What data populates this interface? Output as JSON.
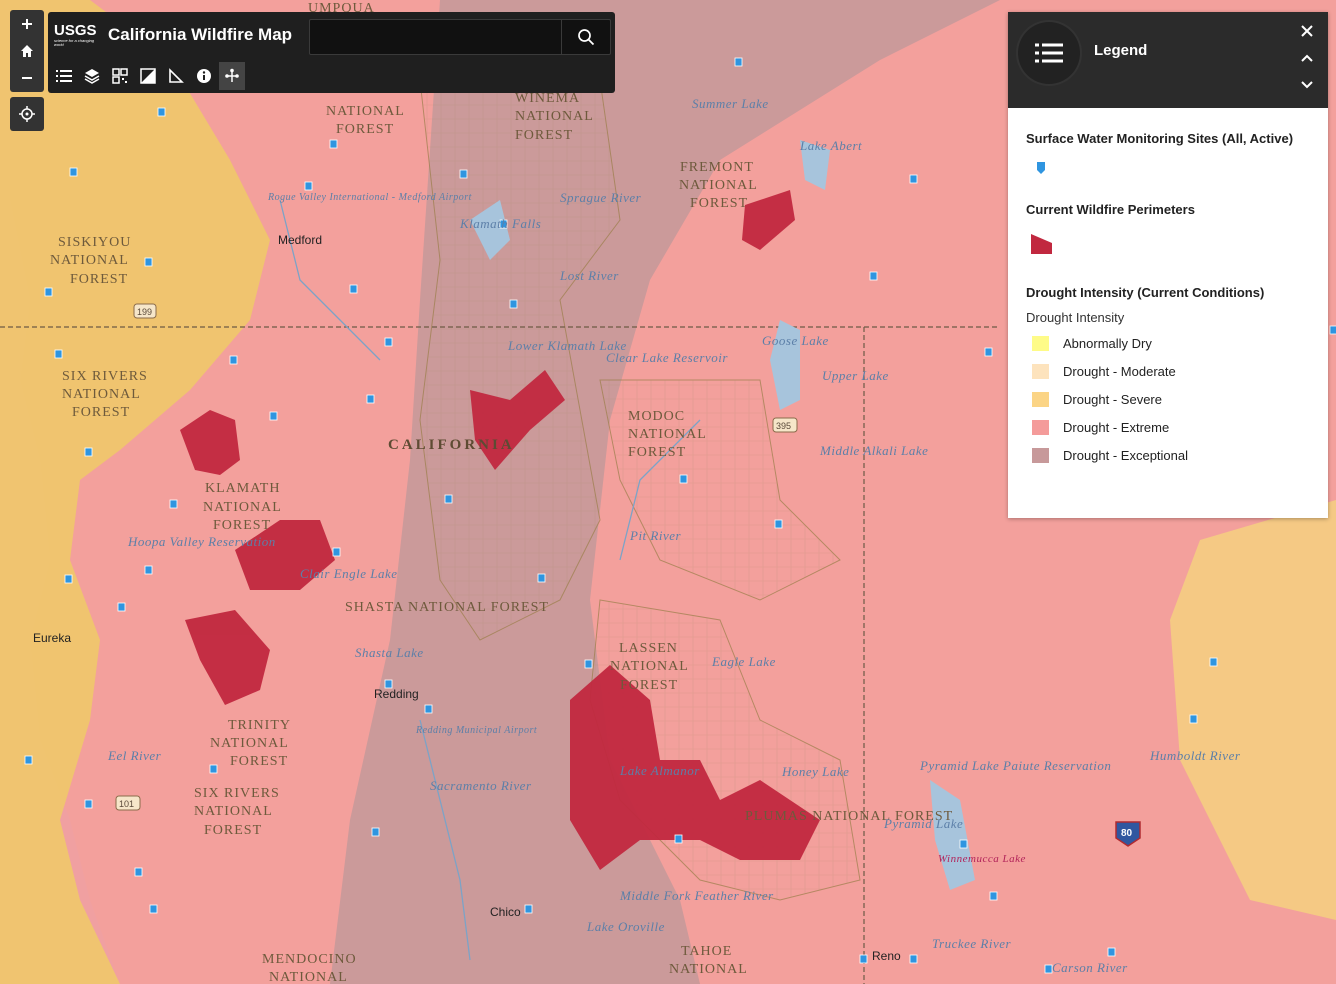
{
  "app": {
    "org_logo": "USGS",
    "org_tagline": "science for a changing world",
    "title": "California Wildfire Map",
    "search_placeholder": ""
  },
  "toolbar": [
    "list-icon",
    "layers-icon",
    "qr-icon",
    "basemap-icon",
    "measure-icon",
    "info-icon",
    "share-icon"
  ],
  "legend": {
    "title": "Legend",
    "sections": [
      {
        "heading": "Surface Water Monitoring Sites (All, Active)",
        "symbol_color": "#2f95e0"
      },
      {
        "heading": "Current Wildfire Perimeters",
        "symbol_color": "#c1283f"
      },
      {
        "heading": "Drought Intensity (Current Conditions)",
        "subheading": "Drought Intensity",
        "items": [
          {
            "label": "Abnormally Dry",
            "color": "#fefb88"
          },
          {
            "label": "Drought - Moderate",
            "color": "#fde3bd"
          },
          {
            "label": "Drought - Severe",
            "color": "#fbd485"
          },
          {
            "label": "Drought - Extreme",
            "color": "#f49b9a"
          },
          {
            "label": "Drought - Exceptional",
            "color": "#c7999a"
          }
        ]
      }
    ]
  },
  "map": {
    "labels": {
      "umpqua": "UMPQUA",
      "national1": "NATIONAL",
      "forest1": "FOREST",
      "winema": "WINEMA",
      "national2": "NATIONAL",
      "forest2": "FOREST",
      "summer_lake": "Summer Lake",
      "fremont": "FREMONT",
      "national3": "NATIONAL",
      "forest3": "FOREST",
      "lake_abert": "Lake Abert",
      "rogue_valley": "Rogue Valley International - Medford Airport",
      "medford": "Medford",
      "klamath_falls": "Klamath Falls",
      "sprague_river": "Sprague River",
      "siskiyou": "SISKIYOU",
      "national4": "NATIONAL",
      "forest4": "FOREST",
      "lost_river": "Lost River",
      "lower_klamath": "Lower Klamath Lake",
      "goose_lake": "Goose Lake",
      "clear_lake": "Clear Lake Reservoir",
      "upper_lake": "Upper Lake",
      "six_rivers": "SIX RIVERS",
      "national5": "NATIONAL",
      "forest5": "FOREST",
      "california": "CALIFORNIA",
      "modoc": "MODOC",
      "national6": "NATIONAL",
      "forest6": "FOREST",
      "middle_alkali": "Middle Alkali Lake",
      "klamath_nf": "KLAMATH",
      "national7": "NATIONAL",
      "forest7": "FOREST",
      "hoopa": "Hoopa Valley Reservation",
      "clair_engle": "Clair Engle Lake",
      "shasta_nf": "SHASTA NATIONAL FOREST",
      "pit_river": "Pit River",
      "eureka": "Eureka",
      "shasta_lake": "Shasta Lake",
      "lassen": "LASSEN",
      "national8": "NATIONAL",
      "forest8": "FOREST",
      "eagle_lake": "Eagle Lake",
      "redding": "Redding",
      "redding_airport": "Redding Municipal Airport",
      "trinity": "TRINITY",
      "national9": "NATIONAL",
      "forest9": "FOREST",
      "eel_river": "Eel River",
      "lake_almanor": "Lake Almanor",
      "honey_lake": "Honey Lake",
      "pyramid_paiute": "Pyramid Lake Paiute Reservation",
      "six_rivers2": "SIX RIVERS",
      "national10": "NATIONAL",
      "forest10": "FOREST",
      "plumas": "PLUMAS NATIONAL FOREST",
      "pyramid_lake": "Pyramid Lake",
      "winnemucca": "Winnemucca Lake",
      "sacramento_river": "Sacramento River",
      "humboldt_river": "Humboldt River",
      "chico": "Chico",
      "middle_fork": "Middle Fork Feather River",
      "lake_oroville": "Lake Oroville",
      "mendocino": "MENDOCINO",
      "national11": "NATIONAL",
      "tahoe": "TAHOE",
      "national12": "NATIONAL",
      "reno": "Reno",
      "truckee": "Truckee River",
      "carson": "Carson River",
      "hwy199": "199",
      "hwy395": "395",
      "hwy101": "101",
      "hwy80": "80"
    }
  }
}
